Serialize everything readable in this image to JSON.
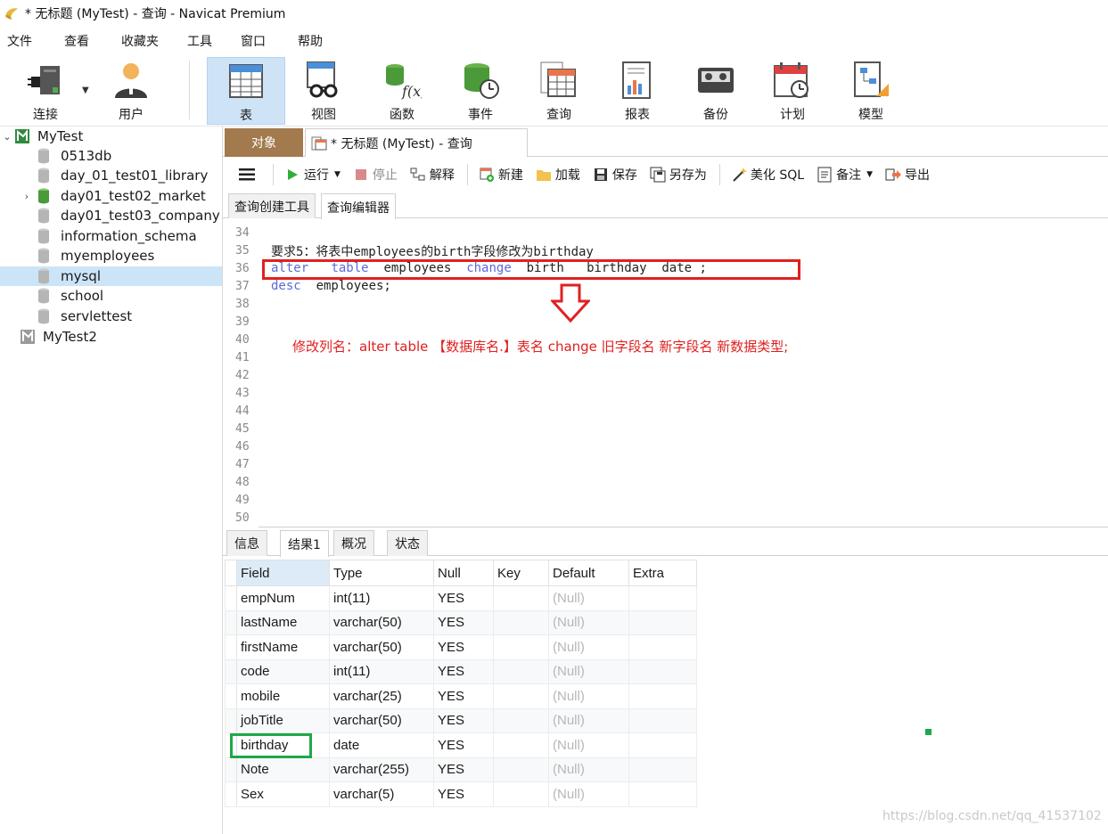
{
  "window": {
    "title": "* 无标题 (MyTest) - 查询 - Navicat Premium"
  },
  "menu": [
    "文件",
    "查看",
    "收藏夹",
    "工具",
    "窗口",
    "帮助"
  ],
  "toolbar": [
    {
      "label": "连接",
      "icon": "plug-icon"
    },
    {
      "label": "用户",
      "icon": "user-icon"
    },
    {
      "label": "表",
      "icon": "table-icon",
      "active": true
    },
    {
      "label": "视图",
      "icon": "view-icon"
    },
    {
      "label": "函数",
      "icon": "function-icon"
    },
    {
      "label": "事件",
      "icon": "event-icon"
    },
    {
      "label": "查询",
      "icon": "query-icon"
    },
    {
      "label": "报表",
      "icon": "report-icon"
    },
    {
      "label": "备份",
      "icon": "backup-icon"
    },
    {
      "label": "计划",
      "icon": "schedule-icon"
    },
    {
      "label": "模型",
      "icon": "model-icon"
    }
  ],
  "nav": {
    "items": [
      {
        "label": "MyTest",
        "type": "connection",
        "expanded": true
      },
      {
        "label": "0513db",
        "type": "db"
      },
      {
        "label": "day_01_test01_library",
        "type": "db"
      },
      {
        "label": "day01_test02_market",
        "type": "db-open"
      },
      {
        "label": "day01_test03_company",
        "type": "db"
      },
      {
        "label": "information_schema",
        "type": "db"
      },
      {
        "label": "myemployees",
        "type": "db"
      },
      {
        "label": "mysql",
        "type": "db",
        "selected": true
      },
      {
        "label": "school",
        "type": "db"
      },
      {
        "label": "servlettest",
        "type": "db"
      },
      {
        "label": "MyTest2",
        "type": "connection-off"
      }
    ]
  },
  "tabs": {
    "object": "对象",
    "query": "* 无标题 (MyTest) - 查询"
  },
  "query_toolbar": {
    "run": "运行",
    "stop": "停止",
    "explain": "解释",
    "new": "新建",
    "load": "加载",
    "save": "保存",
    "save_as": "另存为",
    "beautify": "美化 SQL",
    "comment": "备注",
    "export": "导出"
  },
  "editor_tabs": {
    "builder": "查询创建工具",
    "editor": "查询编辑器"
  },
  "editor": {
    "line_numbers": [
      "34",
      "35",
      "36",
      "37",
      "38",
      "39",
      "40",
      "41",
      "42",
      "43",
      "44",
      "45",
      "46",
      "47",
      "48",
      "49",
      "50"
    ],
    "line35": "要求5：将表中employees的birth字段修改为birthday",
    "line36": {
      "kw1": "alter",
      "kw2": "table",
      "t1": "employees",
      "kw3": "change",
      "t2": "birth",
      "t3": "birthday",
      "t4": "date ;"
    },
    "line37": {
      "kw": "desc",
      "t": "employees;"
    },
    "note": "修改列名：alter  table 【数据库名.】表名  change  旧字段名   新字段名  新数据类型;"
  },
  "result_tabs": [
    "信息",
    "结果1",
    "概况",
    "状态"
  ],
  "grid": {
    "columns": [
      "Field",
      "Type",
      "Null",
      "Key",
      "Default",
      "Extra"
    ],
    "rows": [
      [
        "empNum",
        "int(11)",
        "YES",
        "",
        "(Null)",
        ""
      ],
      [
        "lastName",
        "varchar(50)",
        "YES",
        "",
        "(Null)",
        ""
      ],
      [
        "firstName",
        "varchar(50)",
        "YES",
        "",
        "(Null)",
        ""
      ],
      [
        "code",
        "int(11)",
        "YES",
        "",
        "(Null)",
        ""
      ],
      [
        "mobile",
        "varchar(25)",
        "YES",
        "",
        "(Null)",
        ""
      ],
      [
        "jobTitle",
        "varchar(50)",
        "YES",
        "",
        "(Null)",
        ""
      ],
      [
        "birthday",
        "date",
        "YES",
        "",
        "(Null)",
        ""
      ],
      [
        "Note",
        "varchar(255)",
        "YES",
        "",
        "(Null)",
        ""
      ],
      [
        "Sex",
        "varchar(5)",
        "YES",
        "",
        "(Null)",
        ""
      ]
    ]
  },
  "watermark": "https://blog.csdn.net/qq_41537102",
  "colors": {
    "highlight_red": "#e02020",
    "highlight_green": "#1fa84a",
    "object_tab": "#a27a4e",
    "keyword": "#5a6ad8"
  }
}
